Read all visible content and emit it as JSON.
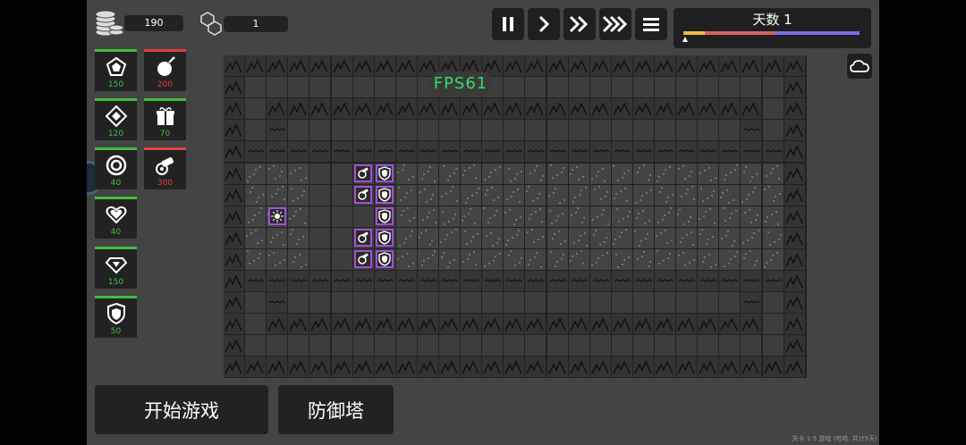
{
  "resources": {
    "coins": "190",
    "cubes": "1"
  },
  "cards": [
    {
      "name": "pentagon-wall",
      "cost": "150",
      "color": "#3fbf3f"
    },
    {
      "name": "bomb",
      "cost": "200",
      "color": "#e04040"
    },
    {
      "name": "diamond-wall",
      "cost": "120",
      "color": "#3fbf3f"
    },
    {
      "name": "gift",
      "cost": "70",
      "color": "#3fbf3f"
    },
    {
      "name": "target-ring",
      "cost": "40",
      "color": "#3fbf3f"
    },
    {
      "name": "cannon",
      "cost": "300",
      "color": "#e04040"
    },
    {
      "name": "heart",
      "cost": "40",
      "color": "#3fbf3f"
    },
    {
      "name": "gem",
      "cost": "150",
      "color": "#3fbf3f"
    },
    {
      "name": "shield",
      "cost": "50",
      "color": "#3fbf3f"
    }
  ],
  "controls": [
    "pause-icon",
    "play-icon",
    "fast-forward-icon",
    "fastest-forward-icon",
    "menu-icon"
  ],
  "day": {
    "label": "天数 1",
    "progress": 0.0
  },
  "fps": "FPS61",
  "buttons": {
    "start": "开始游戏",
    "towers": "防御塔"
  },
  "footer": "关卡 1-5 游戏 (哈哈, 共计5天)",
  "colors": {
    "cost_green": "#3fbf3f",
    "cost_red": "#e04040",
    "unit_border": "#a050d8",
    "fps_text": "#2fe06a"
  }
}
